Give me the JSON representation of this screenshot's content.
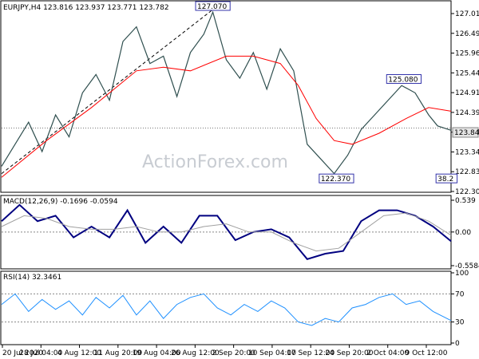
{
  "chart_data": [
    {
      "type": "candlestick",
      "title": "EURJPY,H4  123.816 123.937 123.771 123.782",
      "ylim": [
        122.2,
        127.2
      ],
      "yticks": [
        "127.015",
        "126.490",
        "125.965",
        "125.440",
        "124.915",
        "124.390",
        "123.840",
        "123.340",
        "122.830",
        "122.305"
      ],
      "current_price": "123.840",
      "current_value": 123.84,
      "annotations": [
        {
          "label": "127.070",
          "x": 0.47,
          "y": 127.07
        },
        {
          "label": "125.080",
          "x": 0.895,
          "y": 125.08
        },
        {
          "label": "122.370",
          "x": 0.745,
          "y": 122.37
        },
        {
          "label": "38.2",
          "x": 0.99,
          "y": 122.37
        }
      ],
      "trendline": {
        "from": {
          "x": 0.0,
          "y": 122.6
        },
        "to": {
          "x": 0.47,
          "y": 127.07
        }
      },
      "price_path": [
        [
          0.0,
          122.8
        ],
        [
          0.03,
          123.4
        ],
        [
          0.06,
          124.0
        ],
        [
          0.09,
          123.2
        ],
        [
          0.12,
          124.2
        ],
        [
          0.15,
          123.6
        ],
        [
          0.18,
          124.8
        ],
        [
          0.21,
          125.3
        ],
        [
          0.24,
          124.6
        ],
        [
          0.27,
          126.2
        ],
        [
          0.3,
          126.6
        ],
        [
          0.33,
          125.6
        ],
        [
          0.36,
          125.8
        ],
        [
          0.39,
          124.7
        ],
        [
          0.42,
          125.9
        ],
        [
          0.45,
          126.4
        ],
        [
          0.47,
          127.0
        ],
        [
          0.5,
          125.7
        ],
        [
          0.53,
          125.2
        ],
        [
          0.56,
          125.9
        ],
        [
          0.59,
          124.9
        ],
        [
          0.62,
          126.0
        ],
        [
          0.65,
          125.4
        ],
        [
          0.68,
          123.4
        ],
        [
          0.71,
          123.0
        ],
        [
          0.74,
          122.6
        ],
        [
          0.77,
          123.1
        ],
        [
          0.8,
          123.8
        ],
        [
          0.83,
          124.2
        ],
        [
          0.86,
          124.6
        ],
        [
          0.89,
          125.0
        ],
        [
          0.92,
          124.8
        ],
        [
          0.95,
          124.2
        ],
        [
          0.97,
          123.9
        ],
        [
          1.0,
          123.78
        ]
      ],
      "ma_path": [
        [
          0.0,
          122.5
        ],
        [
          0.1,
          123.5
        ],
        [
          0.2,
          124.4
        ],
        [
          0.3,
          125.4
        ],
        [
          0.36,
          125.5
        ],
        [
          0.42,
          125.4
        ],
        [
          0.5,
          125.8
        ],
        [
          0.56,
          125.8
        ],
        [
          0.62,
          125.6
        ],
        [
          0.66,
          125.0
        ],
        [
          0.7,
          124.1
        ],
        [
          0.74,
          123.5
        ],
        [
          0.78,
          123.4
        ],
        [
          0.84,
          123.7
        ],
        [
          0.9,
          124.1
        ],
        [
          0.95,
          124.4
        ],
        [
          1.0,
          124.3
        ]
      ]
    },
    {
      "type": "line",
      "title": "MACD(12,26,9) -0.1696 -0.0594",
      "ylim": [
        -0.62,
        0.6
      ],
      "yticks": [
        "0.539",
        "0.00",
        "-0.5584"
      ],
      "series": [
        {
          "name": "MACD",
          "color": "#000080",
          "values": [
            [
              0.0,
              0.2
            ],
            [
              0.04,
              0.5
            ],
            [
              0.08,
              0.2
            ],
            [
              0.12,
              0.3
            ],
            [
              0.16,
              -0.1
            ],
            [
              0.2,
              0.1
            ],
            [
              0.24,
              -0.1
            ],
            [
              0.28,
              0.4
            ],
            [
              0.32,
              -0.2
            ],
            [
              0.36,
              0.1
            ],
            [
              0.4,
              -0.2
            ],
            [
              0.44,
              0.3
            ],
            [
              0.48,
              0.3
            ],
            [
              0.52,
              -0.15
            ],
            [
              0.56,
              0.0
            ],
            [
              0.6,
              0.05
            ],
            [
              0.64,
              -0.1
            ],
            [
              0.68,
              -0.5
            ],
            [
              0.72,
              -0.4
            ],
            [
              0.76,
              -0.35
            ],
            [
              0.8,
              0.2
            ],
            [
              0.84,
              0.4
            ],
            [
              0.88,
              0.4
            ],
            [
              0.92,
              0.3
            ],
            [
              0.96,
              0.1
            ],
            [
              1.0,
              -0.17
            ]
          ]
        },
        {
          "name": "Signal",
          "color": "#a0a0a0",
          "values": [
            [
              0.0,
              0.1
            ],
            [
              0.05,
              0.3
            ],
            [
              0.1,
              0.25
            ],
            [
              0.15,
              0.1
            ],
            [
              0.2,
              0.05
            ],
            [
              0.25,
              0.05
            ],
            [
              0.3,
              0.1
            ],
            [
              0.35,
              0.0
            ],
            [
              0.4,
              0.0
            ],
            [
              0.45,
              0.1
            ],
            [
              0.5,
              0.15
            ],
            [
              0.55,
              0.0
            ],
            [
              0.6,
              0.0
            ],
            [
              0.65,
              -0.2
            ],
            [
              0.7,
              -0.35
            ],
            [
              0.75,
              -0.3
            ],
            [
              0.8,
              0.0
            ],
            [
              0.85,
              0.3
            ],
            [
              0.9,
              0.35
            ],
            [
              0.95,
              0.2
            ],
            [
              1.0,
              -0.06
            ]
          ]
        }
      ]
    },
    {
      "type": "line",
      "title": "RSI(14) 32.3461",
      "ylim": [
        0,
        100
      ],
      "yticks": [
        "100",
        "70",
        "30",
        "0"
      ],
      "levels": [
        70,
        30
      ],
      "series": [
        {
          "name": "RSI",
          "color": "#1e90ff",
          "values": [
            [
              0.0,
              55
            ],
            [
              0.03,
              70
            ],
            [
              0.06,
              45
            ],
            [
              0.09,
              62
            ],
            [
              0.12,
              48
            ],
            [
              0.15,
              60
            ],
            [
              0.18,
              40
            ],
            [
              0.21,
              65
            ],
            [
              0.24,
              50
            ],
            [
              0.27,
              68
            ],
            [
              0.3,
              40
            ],
            [
              0.33,
              60
            ],
            [
              0.36,
              35
            ],
            [
              0.39,
              55
            ],
            [
              0.42,
              65
            ],
            [
              0.45,
              70
            ],
            [
              0.48,
              50
            ],
            [
              0.51,
              40
            ],
            [
              0.54,
              55
            ],
            [
              0.57,
              45
            ],
            [
              0.6,
              60
            ],
            [
              0.63,
              50
            ],
            [
              0.66,
              30
            ],
            [
              0.69,
              25
            ],
            [
              0.72,
              35
            ],
            [
              0.75,
              30
            ],
            [
              0.78,
              50
            ],
            [
              0.81,
              55
            ],
            [
              0.84,
              65
            ],
            [
              0.87,
              70
            ],
            [
              0.9,
              55
            ],
            [
              0.93,
              60
            ],
            [
              0.96,
              45
            ],
            [
              1.0,
              32
            ]
          ]
        }
      ]
    }
  ],
  "x_labels": [
    "20 Jul 2020",
    "28 Jul 04:00",
    "4 Aug 12:00",
    "11 Aug 20:00",
    "19 Aug 04:00",
    "26 Aug 12:00",
    "2 Sep 20:00",
    "10 Sep 04:00",
    "17 Sep 12:00",
    "24 Sep 20:00",
    "2 Oct 04:00",
    "9 Oct 12:00"
  ],
  "watermark": "ActionForex.com",
  "colors": {
    "candle": "#2f4f4f",
    "ma": "#ff0000",
    "macd": "#000080",
    "signal": "#a0a0a0",
    "rsi": "#1e90ff",
    "grid": "#c0c0c0"
  }
}
